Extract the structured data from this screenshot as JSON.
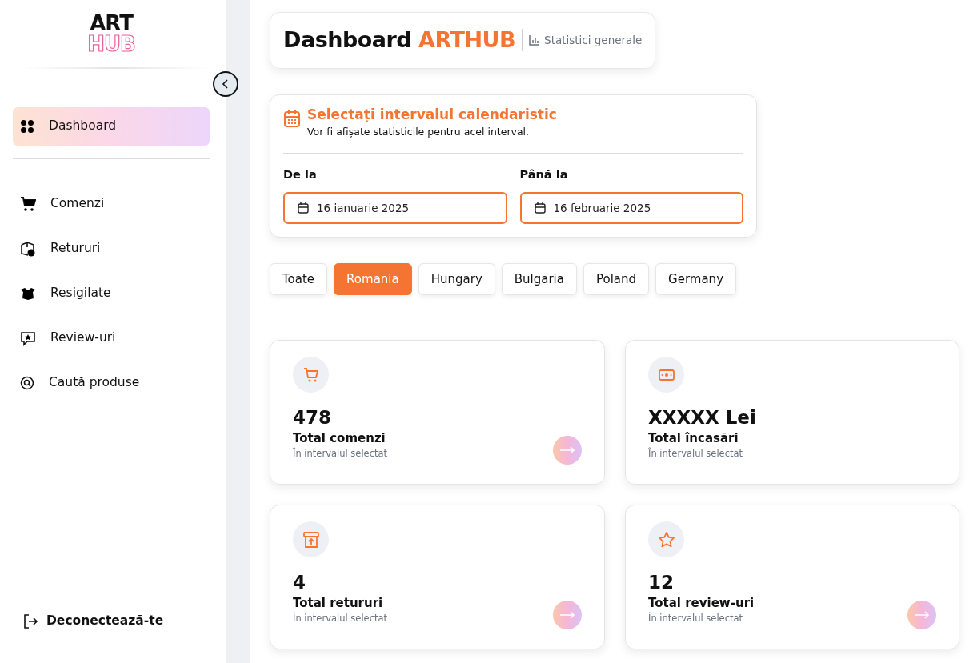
{
  "logo": {
    "top": "ART",
    "bottom": "HUB"
  },
  "sidebar": {
    "items": [
      {
        "label": "Dashboard",
        "selected": true
      },
      {
        "label": "Comenzi",
        "selected": false
      },
      {
        "label": "Retururi",
        "selected": false
      },
      {
        "label": "Resigilate",
        "selected": false
      },
      {
        "label": "Review-uri",
        "selected": false
      },
      {
        "label": "Caută produse",
        "selected": false
      }
    ],
    "logout": "Deconectează-te"
  },
  "header": {
    "title": "Dashboard",
    "brand": "ARTHUB",
    "subtitle": "Statistici generale"
  },
  "date_range": {
    "title": "Selectați intervalul calendaristic",
    "description": "Vor fi afișate statisticile pentru acel interval.",
    "from": {
      "label": "De la",
      "value": "16 ianuarie 2025"
    },
    "to": {
      "label": "Până la",
      "value": "16 februarie 2025"
    }
  },
  "countries": [
    {
      "label": "Toate",
      "selected": false
    },
    {
      "label": "Romania",
      "selected": true
    },
    {
      "label": "Hungary",
      "selected": false
    },
    {
      "label": "Bulgaria",
      "selected": false
    },
    {
      "label": "Poland",
      "selected": false
    },
    {
      "label": "Germany",
      "selected": false
    }
  ],
  "stats": [
    {
      "value": "478",
      "label": "Total comenzi",
      "note": "În intervalul selectat",
      "has_arrow": true
    },
    {
      "value": "XXXXX Lei",
      "label": "Total încasări",
      "note": "În intervalul selectat",
      "has_arrow": false
    },
    {
      "value": "4",
      "label": "Total retururi",
      "note": "În intervalul selectat",
      "has_arrow": true
    },
    {
      "value": "12",
      "label": "Total review-uri",
      "note": "În intervalul selectat",
      "has_arrow": true
    }
  ]
}
